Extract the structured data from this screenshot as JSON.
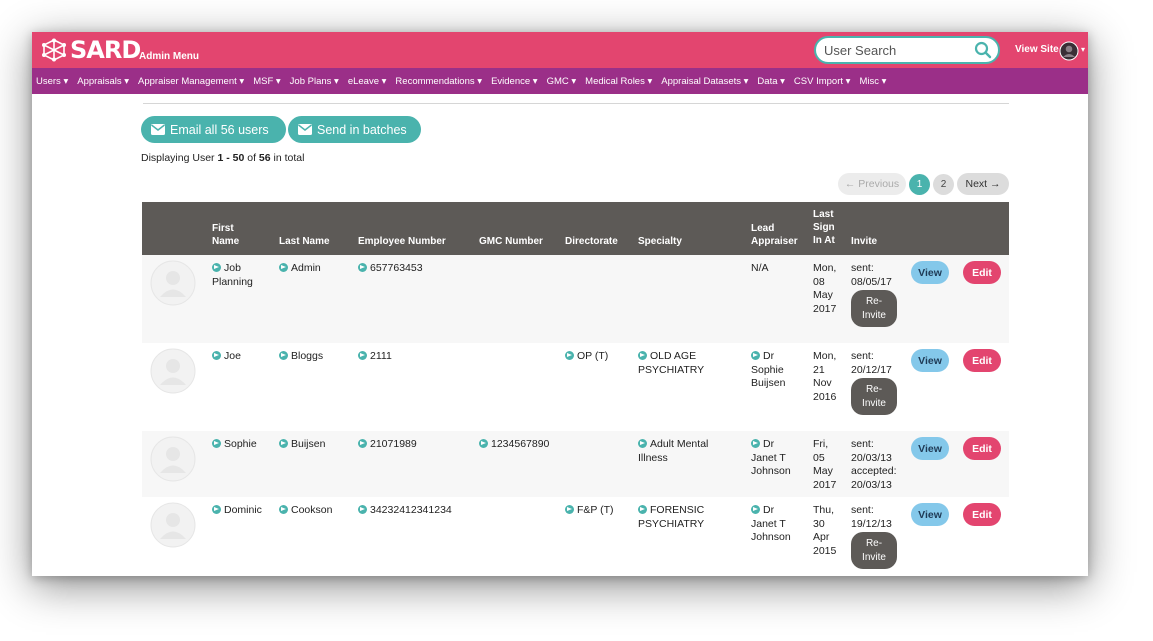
{
  "header": {
    "brand": "SARD",
    "subtitle": "Admin Menu",
    "search_placeholder": "User Search",
    "view_site": "View Site"
  },
  "nav": [
    "Users",
    "Appraisals",
    "Appraiser Management",
    "MSF",
    "Job Plans",
    "eLeave",
    "Recommendations",
    "Evidence",
    "GMC",
    "Medical Roles",
    "Appraisal Datasets",
    "Data",
    "CSV Import",
    "Misc"
  ],
  "actions": {
    "email_all": "Email all 56 users",
    "send_batches": "Send in batches"
  },
  "summary": {
    "prefix": "Displaying User ",
    "range": "1 - 50",
    "mid": " of ",
    "total": "56",
    "suffix": " in total"
  },
  "pagination": {
    "previous": "← Previous",
    "pages": [
      "1",
      "2"
    ],
    "current": "1",
    "next": "Next →"
  },
  "columns": {
    "first_name": [
      "First",
      "Name"
    ],
    "last_name": "Last Name",
    "employee_number": "Employee Number",
    "gmc_number": "GMC Number",
    "directorate": "Directorate",
    "specialty": "Specialty",
    "lead_appraiser": [
      "Lead",
      "Appraiser"
    ],
    "last_sign_in": [
      "Last",
      "Sign",
      "In At"
    ],
    "invite": "Invite"
  },
  "rows": [
    {
      "first": [
        "Job",
        "Planning"
      ],
      "last": "Admin",
      "employee": "657763453",
      "gmc": "",
      "directorate": "",
      "specialty": [],
      "lead": [
        "N/A"
      ],
      "lead_link": false,
      "signin": [
        "Mon,",
        "08",
        "May",
        "2017"
      ],
      "invite": [
        "sent:",
        "08/05/17"
      ],
      "reinvite": true,
      "reinvite_label": [
        "Re-",
        "Invite"
      ],
      "view": "View",
      "edit": "Edit"
    },
    {
      "first": [
        "Joe"
      ],
      "last": "Bloggs",
      "employee": "2111",
      "gmc": "",
      "directorate": "OP (T)",
      "specialty": [
        "OLD AGE",
        "PSYCHIATRY"
      ],
      "lead": [
        "Dr",
        "Sophie",
        "Buijsen"
      ],
      "lead_link": true,
      "signin": [
        "Mon,",
        "21",
        "Nov",
        "2016"
      ],
      "invite": [
        "sent:",
        "20/12/17"
      ],
      "reinvite": true,
      "reinvite_label": [
        "Re-",
        "Invite"
      ],
      "view": "View",
      "edit": "Edit"
    },
    {
      "first": [
        "Sophie"
      ],
      "last": "Buijsen",
      "employee": "21071989",
      "gmc": "1234567890",
      "directorate": "",
      "specialty": [
        "Adult Mental",
        "Illness"
      ],
      "lead": [
        "Dr",
        "Janet T",
        "Johnson"
      ],
      "lead_link": true,
      "signin": [
        "Fri,",
        "05",
        "May",
        "2017"
      ],
      "invite": [
        "sent:",
        "20/03/13",
        "accepted:",
        "20/03/13"
      ],
      "reinvite": false,
      "view": "View",
      "edit": "Edit"
    },
    {
      "first": [
        "Dominic"
      ],
      "last": "Cookson",
      "employee": "34232412341234",
      "gmc": "",
      "directorate": "F&P (T)",
      "specialty": [
        "FORENSIC",
        "PSYCHIATRY"
      ],
      "lead": [
        "Dr",
        "Janet T",
        "Johnson"
      ],
      "lead_link": true,
      "signin": [
        "Thu,",
        "30",
        "Apr",
        "2015"
      ],
      "invite": [
        "sent:",
        "19/12/13"
      ],
      "reinvite": true,
      "reinvite_label": [
        "Re-",
        "Invite"
      ],
      "view": "View",
      "edit": "Edit"
    }
  ],
  "colors": {
    "header_pink": "#e3456f",
    "nav_purple": "#9b2f88",
    "teal": "#4ab3ad",
    "table_header": "#5d5a57",
    "view_blue": "#84c8ea"
  }
}
